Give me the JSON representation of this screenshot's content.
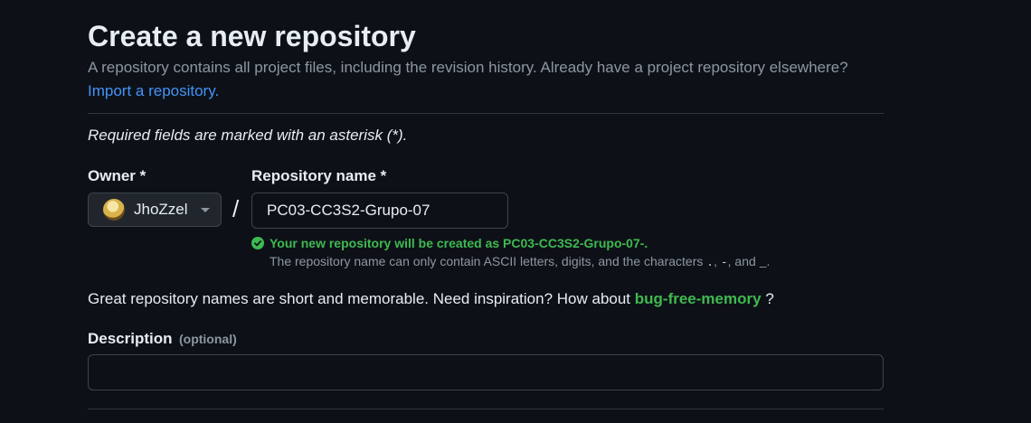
{
  "header": {
    "title": "Create a new repository",
    "intro_text": "A repository contains all project files, including the revision history. Already have a project repository elsewhere?",
    "import_link": "Import a repository."
  },
  "form": {
    "required_note": "Required fields are marked with an asterisk (*).",
    "owner": {
      "label": "Owner *",
      "selected": "JhoZzel"
    },
    "separator": "/",
    "repo_name": {
      "label": "Repository name *",
      "value": "PC03-CC3S2-Grupo-07"
    },
    "availability": {
      "message": "Your new repository will be created as PC03-CC3S2-Grupo-07-.",
      "hint_prefix": "The repository name can only contain ASCII letters, digits, and the characters",
      "char_dot": ".",
      "char_dash": "-",
      "hint_and": ", and",
      "char_underscore": "_",
      "hint_suffix": "."
    },
    "suggestion": {
      "prefix": "Great repository names are short and memorable. Need inspiration? How about",
      "name": "bug-free-memory",
      "suffix": "?"
    },
    "description": {
      "label": "Description",
      "optional": "(optional)",
      "value": ""
    }
  },
  "colors": {
    "background": "#0d1117",
    "accent_link": "#4493f8",
    "success": "#3fb950",
    "muted": "#8d96a0"
  }
}
